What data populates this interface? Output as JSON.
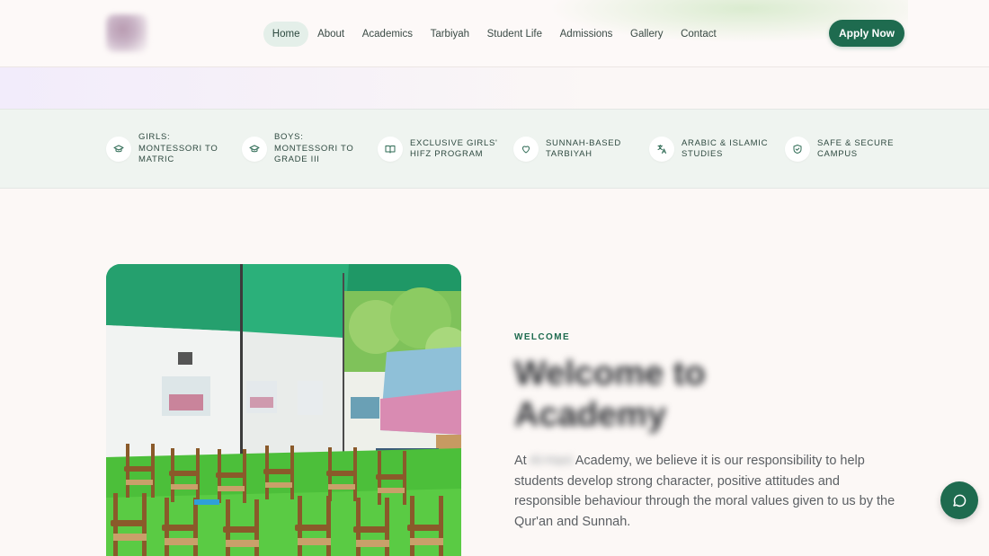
{
  "header": {
    "nav": [
      {
        "label": "Home",
        "active": true
      },
      {
        "label": "About"
      },
      {
        "label": "Academics"
      },
      {
        "label": "Tarbiyah"
      },
      {
        "label": "Student Life"
      },
      {
        "label": "Admissions"
      },
      {
        "label": "Gallery"
      },
      {
        "label": "Contact"
      }
    ],
    "apply_label": "Apply Now"
  },
  "features": [
    {
      "icon": "graduation-cap-icon",
      "label": "GIRLS: MONTESSORI TO MATRIC"
    },
    {
      "icon": "graduation-cap-icon",
      "label": "BOYS: MONTESSORI TO GRADE III"
    },
    {
      "icon": "book-open-icon",
      "label": "EXCLUSIVE GIRLS' HIFZ PROGRAM"
    },
    {
      "icon": "heart-icon",
      "label": "SUNNAH-BASED TARBIYAH"
    },
    {
      "icon": "translate-icon",
      "label": "ARABIC & ISLAMIC STUDIES"
    },
    {
      "icon": "shield-check-icon",
      "label": "SAFE & SECURE CAMPUS"
    }
  ],
  "welcome": {
    "eyebrow": "WELCOME",
    "title": "Welcome to Academy",
    "body_prefix": "At",
    "body_name": "Al-Hani",
    "body_rest": "Academy, we believe it is our responsibility to help students develop strong character, positive attitudes and responsible behaviour through the moral values given to us by the Qur'an and Sunnah."
  },
  "colors": {
    "brand": "#1e6b4f",
    "features_bg": "#eff4f0",
    "page_bg": "#fcf8f6"
  },
  "chat": {
    "icon": "chat-bubble-icon"
  }
}
